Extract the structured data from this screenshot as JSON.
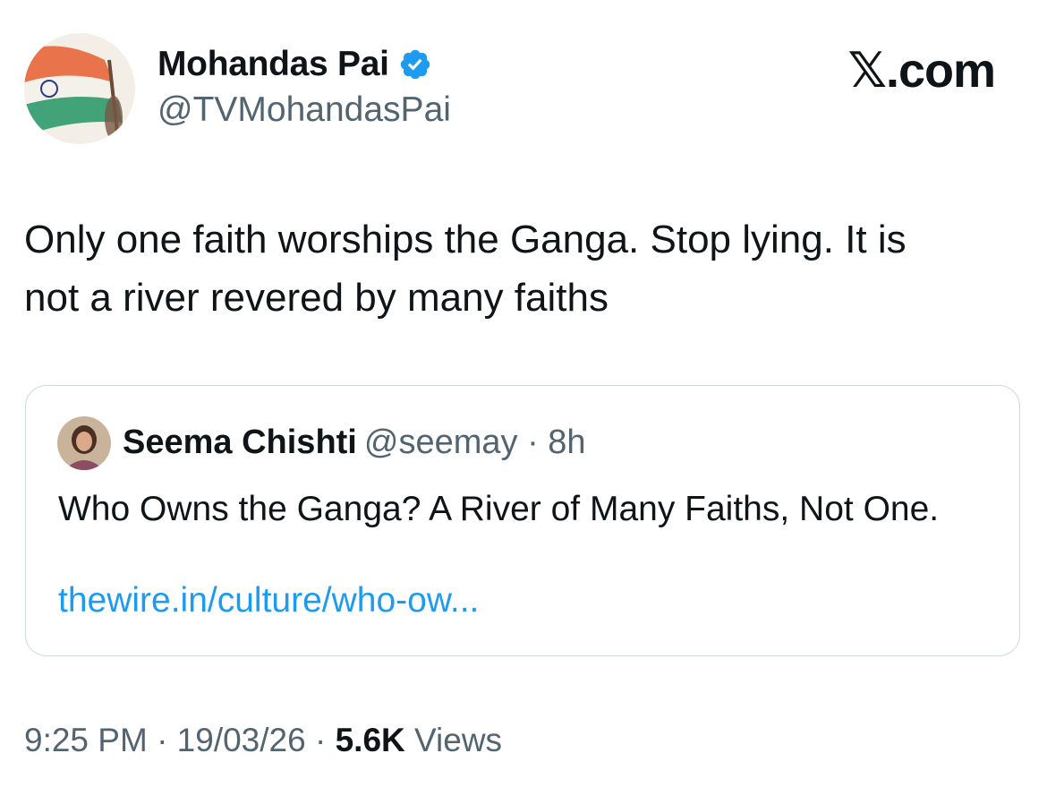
{
  "author": {
    "display_name": "Mohandas Pai",
    "handle": "@TVMohandasPai",
    "verified": true
  },
  "brand": "𝕏.com",
  "tweet": {
    "text_line1": "Only one faith worships the Ganga. Stop lying. It is",
    "text_line2": "not a river revered by many faiths"
  },
  "quoted": {
    "display_name": "Seema Chishti",
    "handle_time": "@seemay · 8h",
    "text": "Who Owns the Ganga? A River of Many Faiths, Not One.",
    "link": "thewire.in/culture/who-ow..."
  },
  "footer": {
    "time": "9:25 PM · 19/03/26 · ",
    "views_count": "5.6K",
    "views_label": " Views"
  },
  "colors": {
    "text_primary": "#0f1419",
    "text_secondary": "#536471",
    "link": "#1d9bf0",
    "verified_badge": "#1d9bf0",
    "card_border": "#cfd9de"
  },
  "icons": {
    "verified": "verified-badge-icon"
  }
}
